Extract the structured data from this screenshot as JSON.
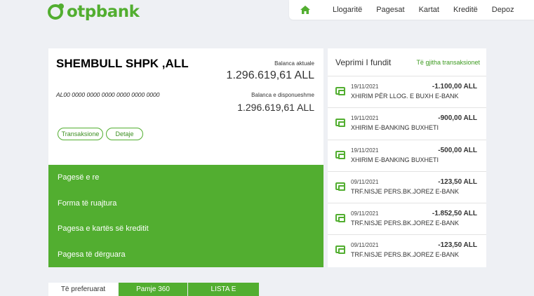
{
  "brand": {
    "logo_text": "otpbank",
    "accent": "#52ae30"
  },
  "nav": {
    "home_icon": "home-icon",
    "items": [
      "Llogaritë",
      "Pagesat",
      "Kartat",
      "Kreditë",
      "Depoz"
    ]
  },
  "account": {
    "name": "SHEMBULL SHPK ,ALL",
    "iban": "AL00 0000 0000 0000 0000 0000 0000",
    "current_balance_label": "Balanca aktuale",
    "current_balance": "1.296.619,61 ALL",
    "available_balance_label": "Balanca e disponueshme",
    "available_balance": "1.296.619,61 ALL",
    "buttons": {
      "transactions": "Transaksione",
      "details": "Detaje"
    }
  },
  "menu": {
    "items": [
      "Pagesë e re",
      "Forma të ruajtura",
      "Pagesa e kartës së kreditit",
      "Pagesa të dërguara"
    ]
  },
  "latest": {
    "title": "Veprimi I fundit",
    "all_link": "Të gjitha transaksionet",
    "rows": [
      {
        "date": "19/11/2021",
        "amount": "-1.100,00 ALL",
        "desc": "XHIRIM PËR LLOG. E BUXH E-BANK"
      },
      {
        "date": "19/11/2021",
        "amount": "-900,00 ALL",
        "desc": "XHIRIM E-BANKING BUXHETI"
      },
      {
        "date": "19/11/2021",
        "amount": "-500,00 ALL",
        "desc": "XHIRIM E-BANKING BUXHETI"
      },
      {
        "date": "09/11/2021",
        "amount": "-123,50 ALL",
        "desc": "TRF.NISJE PERS.BK.JOREZ E-BANK"
      },
      {
        "date": "09/11/2021",
        "amount": "-1.852,50 ALL",
        "desc": "TRF.NISJE PERS.BK.JOREZ E-BANK"
      },
      {
        "date": "09/11/2021",
        "amount": "-123,50 ALL",
        "desc": "TRF.NISJE PERS.BK.JOREZ E-BANK"
      }
    ]
  },
  "tabs": [
    "Të preferuarat",
    "Pamje 360",
    "LISTA E"
  ]
}
